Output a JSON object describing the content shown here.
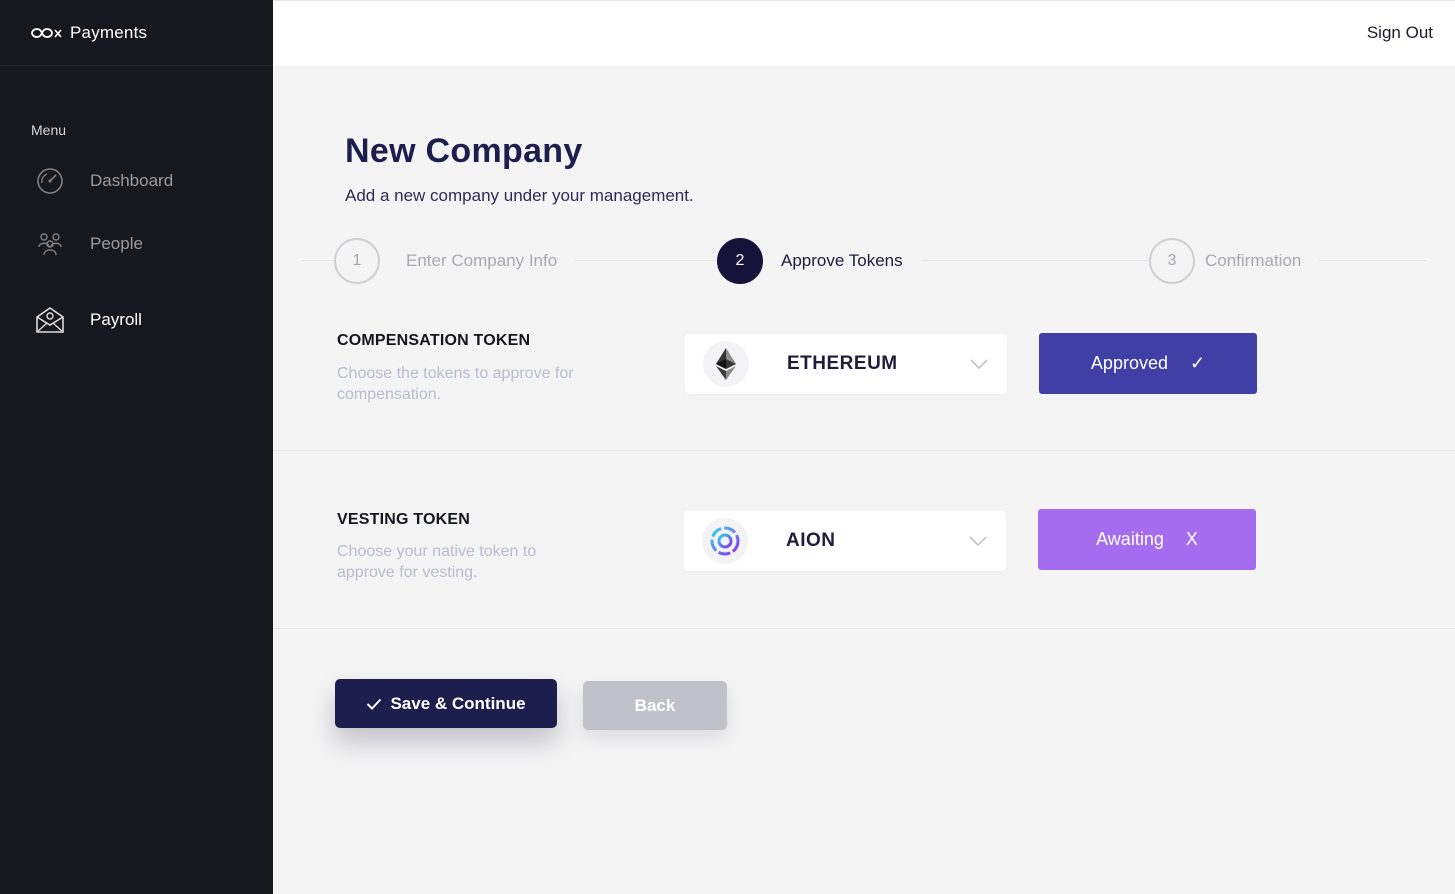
{
  "brand": {
    "name": "Payments",
    "logo_icon": "infinity-x-icon"
  },
  "topbar": {
    "sign_out": "Sign Out"
  },
  "sidebar": {
    "menu_label": "Menu",
    "items": [
      {
        "label": "Dashboard",
        "icon": "speedometer-icon",
        "active": false
      },
      {
        "label": "People",
        "icon": "people-icon",
        "active": false
      },
      {
        "label": "Payroll",
        "icon": "envelope-icon",
        "active": true
      }
    ]
  },
  "page": {
    "title": "New Company",
    "subtitle": "Add a new company under your management."
  },
  "stepper": [
    {
      "number": "1",
      "label": "Enter Company Info",
      "state": "inactive"
    },
    {
      "number": "2",
      "label": "Approve Tokens",
      "state": "active"
    },
    {
      "number": "3",
      "label": "Confirmation",
      "state": "inactive"
    }
  ],
  "tokens": {
    "compensation": {
      "title": "COMPENSATION TOKEN",
      "description": "Choose the tokens to approve for compensation.",
      "selected": "ETHEREUM",
      "icon": "ethereum-icon",
      "status_label": "Approved",
      "status_mark": "✓"
    },
    "vesting": {
      "title": "VESTING TOKEN",
      "description": "Choose your native token to approve for vesting.",
      "selected": "AION",
      "icon": "aion-icon",
      "status_label": "Awaiting",
      "status_mark": "X"
    }
  },
  "actions": {
    "save": "Save & Continue",
    "back": "Back"
  },
  "colors": {
    "sidebar_bg": "#16181d",
    "primary_navy": "#1c1f4d",
    "approved": "#3f3fa6",
    "awaiting": "#a56cf0",
    "back_button": "#c1c1ca"
  }
}
